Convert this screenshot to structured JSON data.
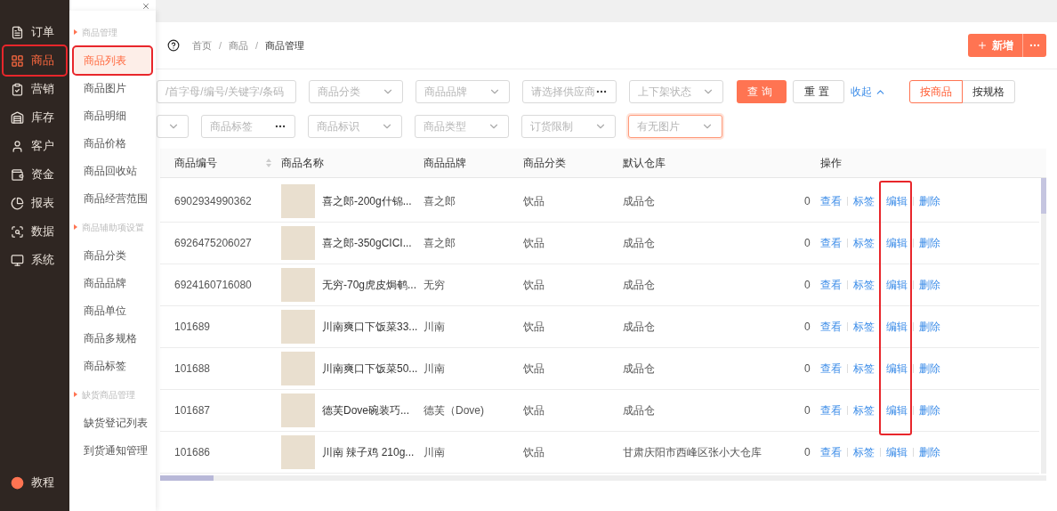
{
  "sidebar": {
    "items": [
      {
        "label": "订单",
        "selected": false
      },
      {
        "label": "商品",
        "selected": true
      },
      {
        "label": "营销",
        "selected": false
      },
      {
        "label": "库存",
        "selected": false
      },
      {
        "label": "客户",
        "selected": false
      },
      {
        "label": "资金",
        "selected": false
      },
      {
        "label": "报表",
        "selected": false
      },
      {
        "label": "数据",
        "selected": false
      },
      {
        "label": "系统",
        "selected": false
      }
    ],
    "bottom_items": [
      {
        "label": "教程"
      }
    ]
  },
  "submenu": {
    "sections": [
      {
        "title": "商品管理",
        "items": [
          {
            "label": "商品列表",
            "selected": true
          },
          {
            "label": "商品图片",
            "selected": false
          },
          {
            "label": "商品明细",
            "selected": false
          },
          {
            "label": "商品价格",
            "selected": false
          },
          {
            "label": "商品回收站",
            "selected": false
          },
          {
            "label": "商品经营范围",
            "selected": false
          }
        ]
      },
      {
        "title": "商品辅助项设置",
        "items": [
          {
            "label": "商品分类",
            "selected": false
          },
          {
            "label": "商品品牌",
            "selected": false
          },
          {
            "label": "商品单位",
            "selected": false
          },
          {
            "label": "商品多规格",
            "selected": false
          },
          {
            "label": "商品标签",
            "selected": false
          }
        ]
      },
      {
        "title": "缺货商品管理",
        "items": [
          {
            "label": "缺货登记列表",
            "selected": false
          },
          {
            "label": "到货通知管理",
            "selected": false
          }
        ]
      }
    ]
  },
  "header": {
    "breadcrumbs": [
      "首页",
      "商品",
      "商品管理"
    ],
    "breadcrumb_separators": [
      "/",
      "/"
    ],
    "new_button": "新增"
  },
  "filters": [
    [
      {
        "kind": "search",
        "placeholder": "/首字母/编号/关键字/条码",
        "highlighted": false
      },
      {
        "kind": "select",
        "placeholder": "商品分类",
        "highlighted": false
      },
      {
        "kind": "select",
        "placeholder": "商品品牌",
        "highlighted": false
      },
      {
        "kind": "picker",
        "placeholder": "请选择供应商",
        "highlighted": false
      },
      {
        "kind": "select",
        "placeholder": "上下架状态",
        "highlighted": false
      }
    ],
    [
      {
        "kind": "select_narrow",
        "highlighted": false
      },
      {
        "kind": "picker",
        "placeholder": "商品标签",
        "highlighted": false
      },
      {
        "kind": "select",
        "placeholder": "商品标识",
        "highlighted": false
      },
      {
        "kind": "select",
        "placeholder": "商品类型",
        "highlighted": false
      },
      {
        "kind": "select",
        "placeholder": "订货限制",
        "highlighted": false
      },
      {
        "kind": "select",
        "placeholder": "有无图片",
        "highlighted": true
      }
    ]
  ],
  "buttons": {
    "query": "查询",
    "reset": "重置",
    "collapse": "收起"
  },
  "view_toggle": [
    {
      "label": "按商品",
      "selected": true
    },
    {
      "label": "按规格",
      "selected": false
    }
  ],
  "table": {
    "columns": [
      "商品编号",
      "商品名称",
      "商品品牌",
      "商品分类",
      "默认仓库",
      "操作"
    ],
    "rows": [
      {
        "code": "6902934990362",
        "name": "喜之郎-200g什锦...",
        "brand": "喜之郎",
        "category": "饮品",
        "warehouse": "成品仓",
        "column_6": "0",
        "actions": [
          "查看",
          "标签",
          "编辑",
          "删除"
        ]
      },
      {
        "code": "6926475206027",
        "name": "喜之郎-350gCICI...",
        "brand": "喜之郎",
        "category": "饮品",
        "warehouse": "成品仓",
        "column_6": "0",
        "actions": [
          "查看",
          "标签",
          "编辑",
          "删除"
        ]
      },
      {
        "code": "6924160716080",
        "name": "无穷-70g虎皮焗鹌...",
        "brand": "无穷",
        "category": "饮品",
        "warehouse": "成品仓",
        "column_6": "0",
        "actions": [
          "查看",
          "标签",
          "编辑",
          "删除"
        ]
      },
      {
        "code": "101689",
        "name": "川南爽口下饭菜33...",
        "brand": "川南",
        "category": "饮品",
        "warehouse": "成品仓",
        "column_6": "0",
        "actions": [
          "查看",
          "标签",
          "编辑",
          "删除"
        ]
      },
      {
        "code": "101688",
        "name": "川南爽口下饭菜50...",
        "brand": "川南",
        "category": "饮品",
        "warehouse": "成品仓",
        "column_6": "0",
        "actions": [
          "查看",
          "标签",
          "编辑",
          "删除"
        ]
      },
      {
        "code": "101687",
        "name": "德芙Dove碗装巧...",
        "brand": "德芙（Dove)",
        "category": "饮品",
        "warehouse": "成品仓",
        "column_6": "0",
        "actions": [
          "查看",
          "标签",
          "编辑",
          "删除"
        ]
      },
      {
        "code": "101686",
        "name": "川南 辣子鸡 210g...",
        "brand": "川南",
        "category": "饮品",
        "warehouse": "甘肃庆阳市西峰区张小大仓库",
        "column_6": "0",
        "actions": [
          "查看",
          "标签",
          "编辑",
          "删除"
        ]
      }
    ]
  }
}
